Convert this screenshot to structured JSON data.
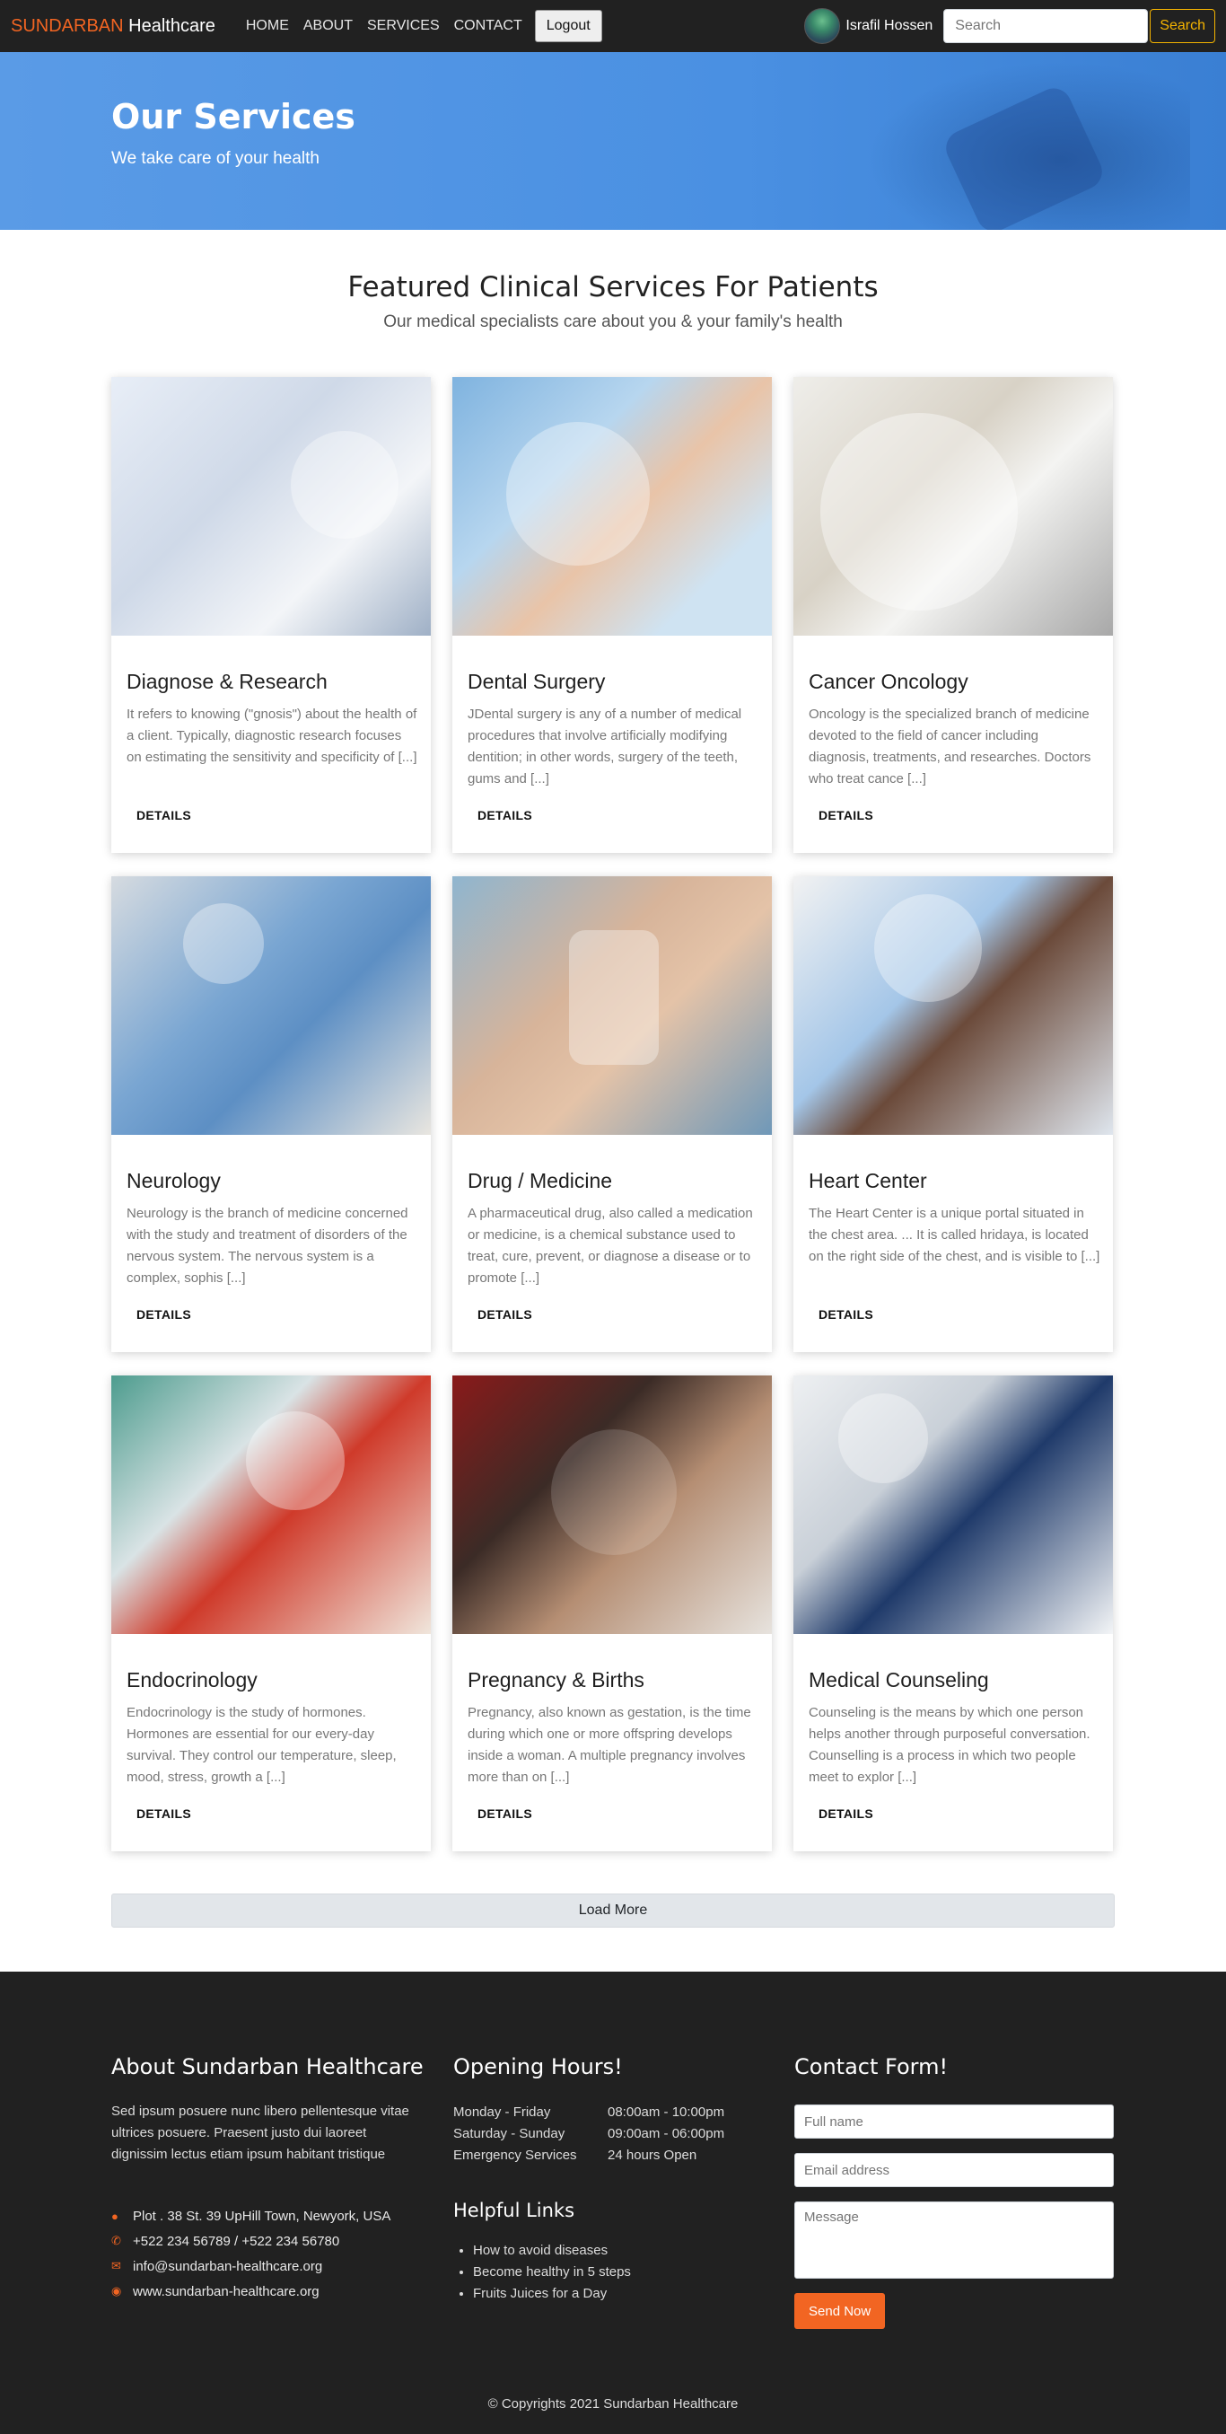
{
  "nav": {
    "brand_accent": "SUNDARBAN",
    "brand_rest": " Healthcare",
    "links": [
      "HOME",
      "ABOUT",
      "SERVICES",
      "CONTACT"
    ],
    "logout_label": "Logout",
    "user_name": "Israfil Hossen",
    "search_placeholder": "Search",
    "search_label": "Search"
  },
  "hero": {
    "title": "Our Services",
    "subtitle": "We take care of your health"
  },
  "section": {
    "title": "Featured Clinical Services For Patients",
    "subtitle": "Our medical specialists care about you & your family's health"
  },
  "services": [
    {
      "title": "Diagnose & Research",
      "text": "It refers to knowing (\"gnosis\") about the health of a client. Typically, diagnostic research focuses on estimating the sensitivity and specificity of [...]",
      "button": "DETAILS"
    },
    {
      "title": "Dental Surgery",
      "text": "JDental surgery is any of a number of medical procedures that involve artificially modifying dentition; in other words, surgery of the teeth, gums and [...]",
      "button": "DETAILS"
    },
    {
      "title": "Cancer Oncology",
      "text": "Oncology is the specialized branch of medicine devoted to the field of cancer including diagnosis, treatments, and researches. Doctors who treat cance [...]",
      "button": "DETAILS"
    },
    {
      "title": "Neurology",
      "text": "Neurology is the branch of medicine concerned with the study and treatment of disorders of the nervous system. The nervous system is a complex, sophis [...]",
      "button": "DETAILS"
    },
    {
      "title": "Drug / Medicine",
      "text": "A pharmaceutical drug, also called a medication or medicine, is a chemical substance used to treat, cure, prevent, or diagnose a disease or to promote [...]",
      "button": "DETAILS"
    },
    {
      "title": "Heart Center",
      "text": "The Heart Center is a unique portal situated in the chest area. ... It is called hridaya, is located on the right side of the chest, and is visible to [...]",
      "button": "DETAILS"
    },
    {
      "title": "Endocrinology",
      "text": "Endocrinology is the study of hormones. Hormones are essential for our every-day survival. They control our temperature, sleep, mood, stress, growth a [...]",
      "button": "DETAILS"
    },
    {
      "title": "Pregnancy & Births",
      "text": "Pregnancy, also known as gestation, is the time during which one or more offspring develops inside a woman. A multiple pregnancy involves more than on [...]",
      "button": "DETAILS"
    },
    {
      "title": "Medical Counseling",
      "text": "Counseling is the means by which one person helps another through purposeful conversation. Counselling is a process in which two people meet to explor [...]",
      "button": "DETAILS"
    }
  ],
  "load_more": "Load More",
  "footer": {
    "about_title": "About Sundarban Healthcare",
    "about_text": "Sed ipsum posuere nunc libero pellentesque vitae ultrices posuere. Praesent justo dui laoreet dignissim lectus etiam ipsum habitant tristique",
    "contact": [
      {
        "icon": "map-marker-icon",
        "text": "Plot . 38 St. 39 UpHill Town, Newyork, USA"
      },
      {
        "icon": "phone-icon",
        "text": "+522 234 56789 / +522 234 56780"
      },
      {
        "icon": "envelope-icon",
        "text": "info@sundarban-healthcare.org"
      },
      {
        "icon": "globe-icon",
        "text": "www.sundarban-healthcare.org"
      }
    ],
    "hours_title": "Opening Hours!",
    "hours": [
      {
        "day": "Monday - Friday",
        "time": "08:00am - 10:00pm"
      },
      {
        "day": "Saturday - Sunday",
        "time": "09:00am - 06:00pm"
      },
      {
        "day": "Emergency Services",
        "time": "24 hours Open"
      }
    ],
    "links_title": "Helpful Links",
    "links": [
      "How to avoid diseases",
      "Become healthy in 5 steps",
      "Fruits Juices for a Day"
    ],
    "form_title": "Contact Form!",
    "name_placeholder": "Full name",
    "email_placeholder": "Email address",
    "message_placeholder": "Message",
    "send_label": "Send Now",
    "copyright": "© Copyrights 2021 Sundarban Healthcare"
  },
  "colors": {
    "accent": "#f26522",
    "nav_bg": "#212121",
    "hero_bg": "#4a90e2",
    "search_btn": "#f5b400"
  }
}
